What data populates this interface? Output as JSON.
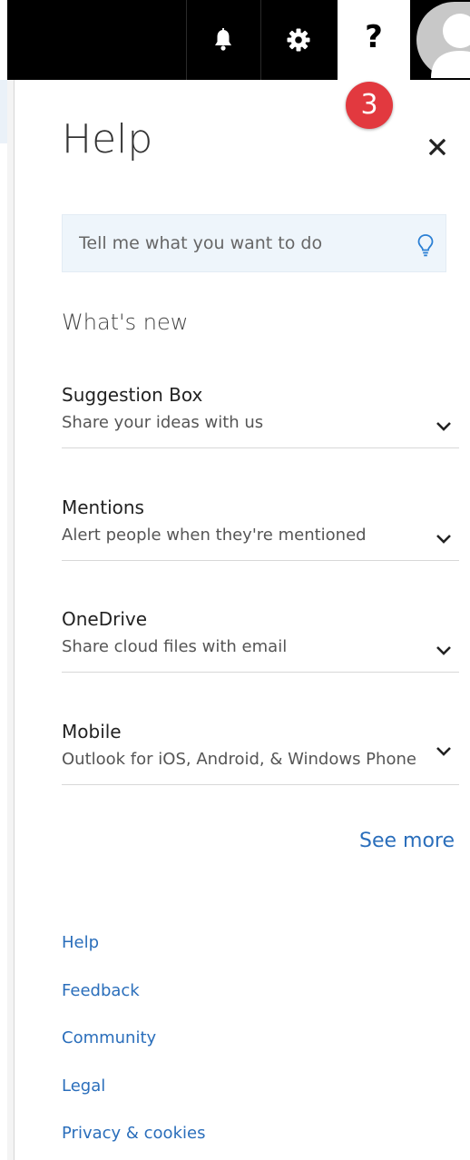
{
  "topbar": {
    "notifications_icon": "bell-icon",
    "settings_icon": "gear-icon",
    "help_icon": "question-mark-icon",
    "help_glyph": "?",
    "avatar_icon": "user-avatar-icon"
  },
  "badge": {
    "number": "3"
  },
  "panel": {
    "title": "Help",
    "close_icon": "close-icon",
    "search": {
      "placeholder": "Tell me what you want to do",
      "value": "",
      "icon": "lightbulb-icon"
    },
    "whats_new_heading": "What's new",
    "items": [
      {
        "title": "Suggestion Box",
        "subtitle": "Share your ideas with us"
      },
      {
        "title": "Mentions",
        "subtitle": "Alert people when they're mentioned"
      },
      {
        "title": "OneDrive",
        "subtitle": "Share cloud files with email"
      },
      {
        "title": "Mobile",
        "subtitle": "Outlook for iOS, Android, & Windows Phone"
      }
    ],
    "see_more": "See more",
    "footer_links": [
      "Help",
      "Feedback",
      "Community",
      "Legal",
      "Privacy & cookies"
    ]
  },
  "colors": {
    "topbar_bg": "#000000",
    "link": "#2a6ebb",
    "badge_bg": "#e2393f",
    "search_bg": "#eef5fb"
  }
}
